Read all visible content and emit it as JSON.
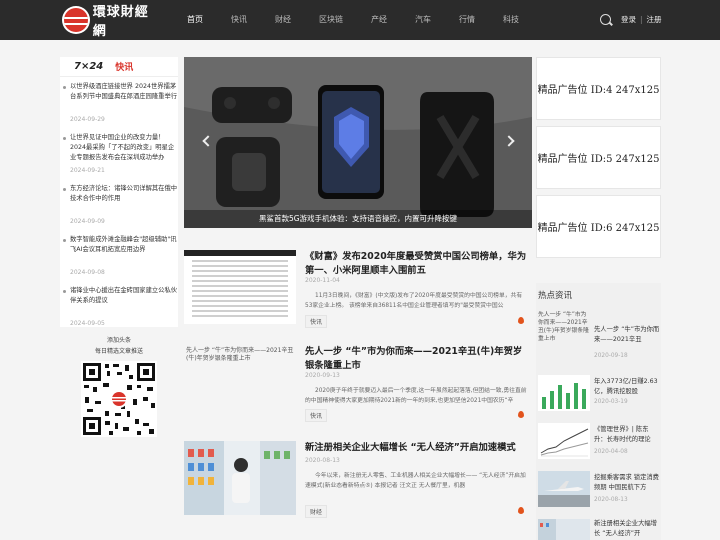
{
  "header": {
    "logo_text": "環球財經網",
    "nav": [
      "首页",
      "快讯",
      "财经",
      "区块链",
      "产经",
      "汽车",
      "行情",
      "科技"
    ],
    "login": "登录",
    "register": "注册",
    "separator": "|"
  },
  "flash": {
    "number": "7×24",
    "label": "快讯",
    "items": [
      {
        "title": "以世界级酒庄链接世界 2024世界擂茅台系列节中国盛典在郎酒庄园隆重举行",
        "date": "2024-09-29"
      },
      {
        "title": "让世界见证中国企业的改变力量！2024最采购「了不起的改变」明星企业专题报告发布会在深圳成功举办",
        "date": "2024-09-21"
      },
      {
        "title": "东方经济论坛：诸锋公司详解其在俄中技术合作中的作用",
        "date": "2024-09-09"
      },
      {
        "title": "数字智能成外滩金融峰会\"超级辅助\"讯飞AI会议耳机拓宽应用边界",
        "date": "2024-09-08"
      },
      {
        "title": "诸锋业中心援出在金砖国家建立公私伙伴关系的提议",
        "date": "2024-09-05"
      }
    ]
  },
  "qr": {
    "line1": "添加头条",
    "line2": "每日精选文章推送"
  },
  "banner": {
    "caption": "黑鲨首款5G游戏手机体验：支持语音操控，内置可升降按键"
  },
  "articles": [
    {
      "title": "《财富》发布2020年度最受赞赏中国公司榜单，华为第一、小米阿里顺丰入围前五",
      "date": "2020-11-04",
      "summary": "11月3日晚间，《财富》(中文版)发布了2020年度最受赞赏的中国公司榜单，共有53家企业上榜。 该榜单来自36811名中国企业管理者填写的\"最受赞赏中国公",
      "tag": "快讯",
      "image_alt": ""
    },
    {
      "title": "先人一步 “牛”市为你而来——2021辛丑(牛)年贺岁银条隆重上市",
      "date": "2020-09-13",
      "summary": "2020庚子年终于就要迈入最后一个季度,这一年虽然起起落落,但团结一致,勇往直前的中国精神使得大家更加期待2021新的一年的到来,也更加坚信2021中国农历“辛",
      "tag": "快讯",
      "image_alt": "先人一步 “牛”市为你而来——2021辛丑(牛)年贺岁银条隆重上市"
    },
    {
      "title": "新注册相关企业大幅增长 “无人经济”开启加速模式",
      "date": "2020-08-13",
      "summary": "今年以来，新注册无人零售、工业机器人相关企业大幅增长——  “无人经济”开启加速模式(新业态看新特点⑤)  本报记者 汪文正  无人餐厅里，机器",
      "tag": "财经",
      "image_alt": ""
    }
  ],
  "ads": [
    "精品广告位 ID:4 247x125",
    "精品广告位 ID:5 247x125",
    "精品广告位 ID:6 247x125"
  ],
  "hot": {
    "heading": "热点资讯",
    "items": [
      {
        "title": "先人一步 “牛”市为你而来——2021辛丑",
        "date": "2020-09-18",
        "thumb_alt": "先人一步 “牛”市为你而来——2021辛丑(牛)年贺岁银条隆重上市"
      },
      {
        "title": "年入3773亿/日赚2.63亿，腾讯挖股股",
        "date": "2020-03-19",
        "thumb_alt": ""
      },
      {
        "title": "《管理世界》| 陈东升：长寿时代的理论",
        "date": "2020-04-08",
        "thumb_alt": ""
      },
      {
        "title": "挖掘乘客需求 锁定消费频期 中国民航下方",
        "date": "2020-08-13",
        "thumb_alt": ""
      },
      {
        "title": "新注册相关企业大幅增长 “无人经济”开",
        "date": "",
        "thumb_alt": "先人一步 “牛”市为你而来——2021辛丑"
      }
    ]
  },
  "colors": {
    "header_bg": "#2b2b2b",
    "accent": "#d9342b",
    "fire": "#e2531c"
  }
}
